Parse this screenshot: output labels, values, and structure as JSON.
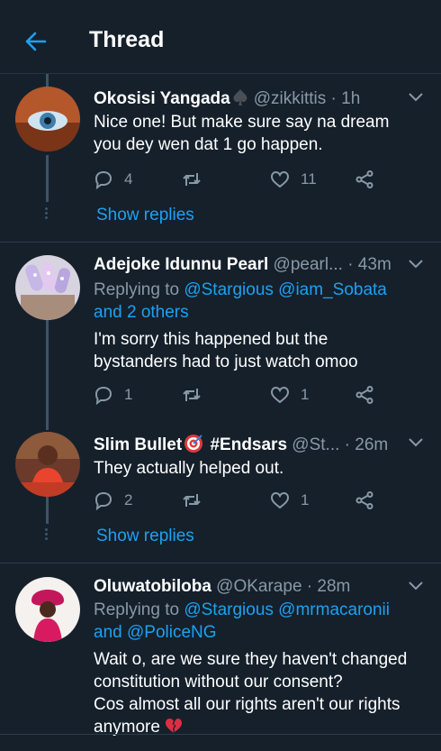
{
  "header": {
    "title": "Thread",
    "back_icon": "arrow-left-icon",
    "accent": "#1da1f2"
  },
  "tweets": [
    {
      "name": "Okosisi Yangada",
      "handle": "@zikkittis",
      "time": "· 1h",
      "name_emoji": "spade",
      "text": [
        "Nice one! But make sure say na dream",
        "you dey wen dat 1 go happen."
      ],
      "replies": "4",
      "retweets": "",
      "likes": "11",
      "show_replies": "Show replies"
    },
    {
      "name": "Adejoke Idunnu Pearl",
      "handle": "@pearl...",
      "time": "· 43m",
      "replying_prefix": "Replying to ",
      "replying_line1": "@Stargious @iam_Sobata",
      "replying_line2": "and 2 others",
      "text": [
        "I'm sorry this happened but the",
        "bystanders had to just watch omoo"
      ],
      "replies": "1",
      "retweets": "",
      "likes": "1"
    },
    {
      "name": "Slim Bullet",
      "name_emoji": "direct-hit",
      "name_suffix": "#Endsars",
      "handle": "@St...",
      "time": "· 26m",
      "text": [
        "They actually helped out."
      ],
      "replies": "2",
      "retweets": "",
      "likes": "1",
      "show_replies": "Show replies"
    },
    {
      "name": "Oluwatobiloba",
      "handle": "@OKarape",
      "time": "· 28m",
      "replying_prefix": "Replying to ",
      "replying_line1": "@Stargious @mrmacaronii",
      "replying_line2": "and @PoliceNG",
      "text": [
        "Wait o, are we sure they haven't changed",
        "constitution without our consent?",
        "Cos almost all our rights aren't our rights",
        "anymore"
      ],
      "text_emoji": "broken-heart"
    }
  ]
}
